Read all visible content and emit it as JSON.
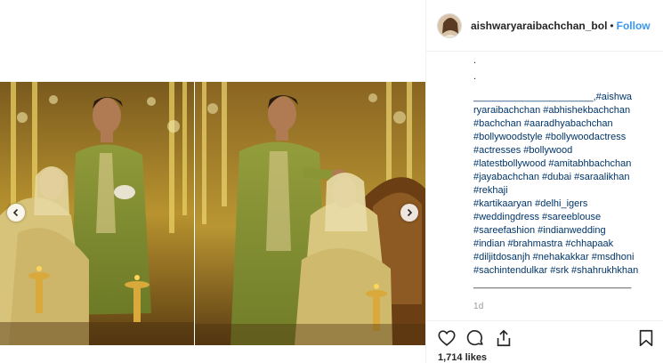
{
  "post": {
    "username": "aishwaryaraibachchan_bol",
    "separator": "•",
    "follow_label": "Follow",
    "caption_dots": [
      ".",
      "."
    ],
    "caption_lines": [
      "______________________,#aishwa",
      "ryaraibachchan #abhishekbachchan",
      "#bachchan #aaradhyabachchan",
      "#bollywoodstyle #bollywoodactress",
      "#actresses #bollywood",
      "#latestbollywood #amitabhbachchan",
      "#jayabachchan #dubai #saraalikhan",
      "#rekhaji",
      "#kartikaaryan #delhi_igers",
      "#weddingdress #sareeblouse",
      "#sareefashion #indianwedding",
      "#indian #brahmastra #chhapaak",
      "#diljitdosanjh #nehakakkar #msdhoni",
      "#sachintendulkar #srk #shahrukhkhan",
      "_____________________________"
    ],
    "timestamp": "1d",
    "likes": "1,714 likes"
  },
  "icons": {
    "prev": "chevron-left-icon",
    "next": "chevron-right-icon",
    "like": "heart-icon",
    "comment": "comment-icon",
    "share": "share-icon",
    "save": "bookmark-icon"
  },
  "colors": {
    "follow": "#3897f0",
    "hashtag": "#003569",
    "text": "#262626",
    "muted": "#999999",
    "border": "#efefef"
  }
}
